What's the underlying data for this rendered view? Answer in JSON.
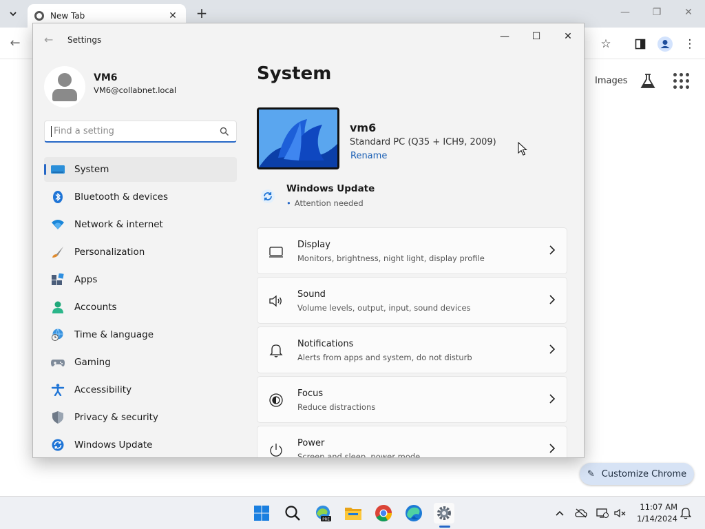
{
  "browser": {
    "tab_title": "New Tab",
    "ntp_images_link": "Images",
    "customize_label": "Customize Chrome"
  },
  "settings": {
    "window_title": "Settings",
    "profile": {
      "name": "VM6",
      "email": "VM6@collabnet.local"
    },
    "search": {
      "placeholder": "Find a setting",
      "value": ""
    },
    "nav": [
      {
        "label": "System",
        "icon": "monitor-icon",
        "selected": true
      },
      {
        "label": "Bluetooth & devices",
        "icon": "bluetooth-icon"
      },
      {
        "label": "Network & internet",
        "icon": "wifi-icon"
      },
      {
        "label": "Personalization",
        "icon": "paintbrush-icon"
      },
      {
        "label": "Apps",
        "icon": "apps-icon"
      },
      {
        "label": "Accounts",
        "icon": "accounts-icon"
      },
      {
        "label": "Time & language",
        "icon": "globe-clock-icon"
      },
      {
        "label": "Gaming",
        "icon": "gamepad-icon"
      },
      {
        "label": "Accessibility",
        "icon": "accessibility-icon"
      },
      {
        "label": "Privacy & security",
        "icon": "shield-icon"
      },
      {
        "label": "Windows Update",
        "icon": "windows-update-icon"
      }
    ],
    "content": {
      "title": "System",
      "device": {
        "name": "vm6",
        "model": "Standard PC (Q35 + ICH9, 2009)",
        "rename_label": "Rename"
      },
      "windows_update": {
        "title": "Windows Update",
        "status": "Attention needed"
      },
      "cards": [
        {
          "title": "Display",
          "subtitle": "Monitors, brightness, night light, display profile",
          "icon": "display-icon"
        },
        {
          "title": "Sound",
          "subtitle": "Volume levels, output, input, sound devices",
          "icon": "speaker-icon"
        },
        {
          "title": "Notifications",
          "subtitle": "Alerts from apps and system, do not disturb",
          "icon": "bell-icon"
        },
        {
          "title": "Focus",
          "subtitle": "Reduce distractions",
          "icon": "focus-icon"
        },
        {
          "title": "Power",
          "subtitle": "Screen and sleep, power mode",
          "icon": "power-icon"
        }
      ]
    }
  },
  "taskbar": {
    "apps": [
      "start-icon",
      "search-icon",
      "edge-preview-icon",
      "file-explorer-icon",
      "chrome-icon",
      "edge-icon",
      "settings-gear-icon"
    ],
    "active_app": "settings-gear-icon",
    "clock": {
      "time": "11:07 AM",
      "date": "1/14/2024"
    }
  },
  "colors": {
    "accent": "#2667c6",
    "link": "#1a5fb4",
    "window_bg": "#f3f3f3",
    "taskbar_bg": "#eef0f4"
  }
}
